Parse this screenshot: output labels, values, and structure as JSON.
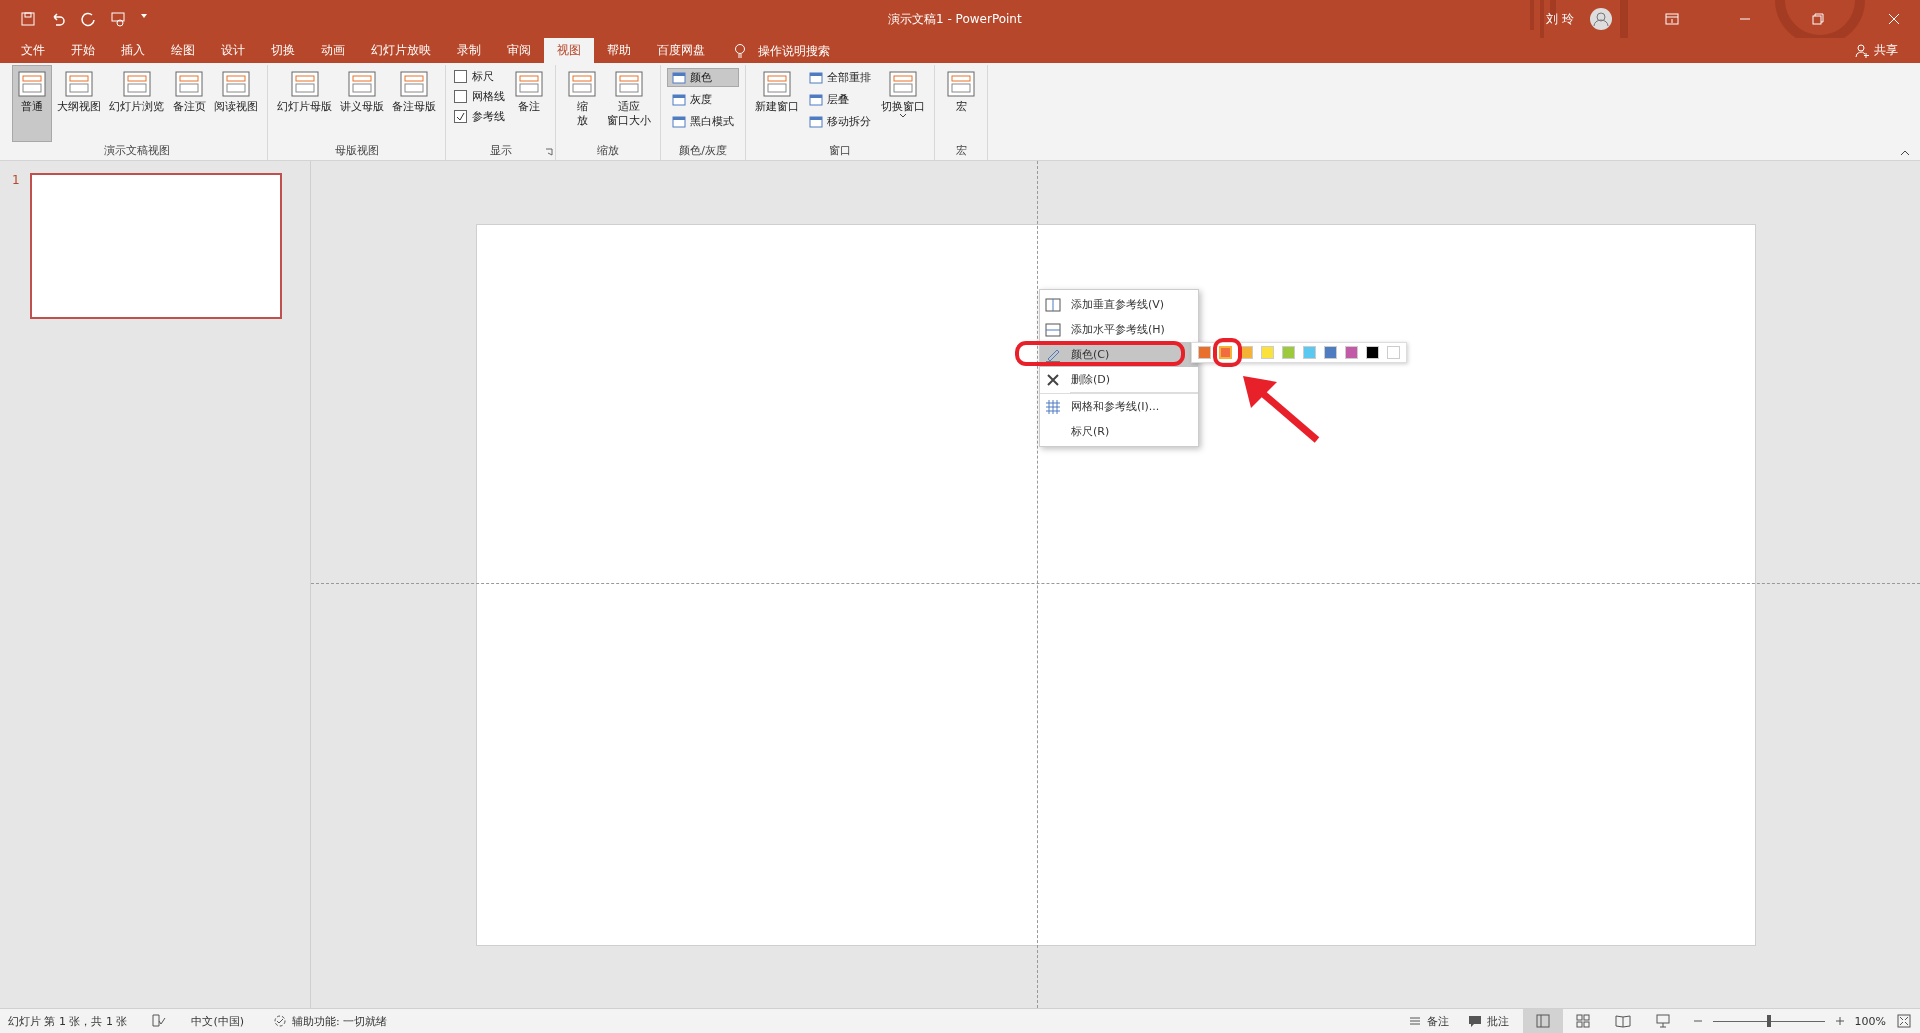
{
  "window": {
    "title": "演示文稿1  -  PowerPoint",
    "user": "刘 玲"
  },
  "tabs": [
    {
      "label": "文件",
      "selected": false
    },
    {
      "label": "开始",
      "selected": false
    },
    {
      "label": "插入",
      "selected": false
    },
    {
      "label": "绘图",
      "selected": false
    },
    {
      "label": "设计",
      "selected": false
    },
    {
      "label": "切换",
      "selected": false
    },
    {
      "label": "动画",
      "selected": false
    },
    {
      "label": "幻灯片放映",
      "selected": false
    },
    {
      "label": "录制",
      "selected": false
    },
    {
      "label": "审阅",
      "selected": false
    },
    {
      "label": "视图",
      "selected": true
    },
    {
      "label": "帮助",
      "selected": false
    },
    {
      "label": "百度网盘",
      "selected": false
    }
  ],
  "search": {
    "placeholder": "操作说明搜索"
  },
  "share": "共享",
  "ribbon": [
    {
      "label": "演示文稿视图",
      "items": [
        {
          "kind": "big",
          "label": "普通",
          "selected": true
        },
        {
          "kind": "big",
          "label": "大纲视图",
          "selected": false
        },
        {
          "kind": "big",
          "label": "幻灯片浏览",
          "selected": false
        },
        {
          "kind": "big",
          "label": "备注页",
          "selected": false
        },
        {
          "kind": "big",
          "label": "阅读视图",
          "selected": false
        }
      ]
    },
    {
      "label": "母版视图",
      "items": [
        {
          "kind": "big",
          "label": "幻灯片母版",
          "selected": false
        },
        {
          "kind": "big",
          "label": "讲义母版",
          "selected": false
        },
        {
          "kind": "big",
          "label": "备注母版",
          "selected": false
        }
      ]
    },
    {
      "label": "显示",
      "launcher": true,
      "items": [
        {
          "kind": "stack",
          "children": [
            {
              "kind": "check",
              "label": "标尺",
              "checked": false
            },
            {
              "kind": "check",
              "label": "网格线",
              "checked": false
            },
            {
              "kind": "check",
              "label": "参考线",
              "checked": true
            }
          ]
        },
        {
          "kind": "big",
          "label": "备注",
          "selected": false
        }
      ]
    },
    {
      "label": "缩放",
      "items": [
        {
          "kind": "big",
          "lines": [
            "缩",
            "放"
          ],
          "selected": false
        },
        {
          "kind": "big",
          "lines": [
            "适应",
            "窗口大小"
          ],
          "selected": false
        }
      ]
    },
    {
      "label": "颜色/灰度",
      "items": [
        {
          "kind": "stack",
          "children": [
            {
              "kind": "small",
              "label": "颜色",
              "selected": true
            },
            {
              "kind": "small",
              "label": "灰度",
              "selected": false
            },
            {
              "kind": "small",
              "label": "黑白模式",
              "selected": false
            }
          ]
        }
      ]
    },
    {
      "label": "窗口",
      "items": [
        {
          "kind": "big",
          "label": "新建窗口",
          "selected": false
        },
        {
          "kind": "stack",
          "children": [
            {
              "kind": "small",
              "label": "全部重排",
              "selected": false
            },
            {
              "kind": "small",
              "label": "层叠",
              "selected": false
            },
            {
              "kind": "small",
              "label": "移动拆分",
              "selected": false
            }
          ]
        },
        {
          "kind": "big",
          "label": "切换窗口",
          "selected": false,
          "dropdown": true
        }
      ]
    },
    {
      "label": "宏",
      "items": [
        {
          "kind": "big",
          "label": "宏",
          "selected": false
        }
      ]
    }
  ],
  "slides": [
    {
      "number": "1",
      "selected": true
    }
  ],
  "context_menu": {
    "items": [
      {
        "label": "添加垂直参考线(V)",
        "kind": "vguide",
        "highlighted": false
      },
      {
        "label": "添加水平参考线(H)",
        "kind": "hguide",
        "highlighted": false
      },
      {
        "label": "颜色(C)",
        "kind": "color",
        "highlighted": true
      },
      {
        "label": "删除(D)",
        "kind": "delete",
        "highlighted": false
      },
      {
        "label": "网格和参考线(I)...",
        "kind": "grid",
        "highlighted": false,
        "separator": true
      },
      {
        "label": "标尺(R)",
        "kind": "none",
        "highlighted": false
      }
    ]
  },
  "palette": [
    {
      "color": "#e8702a",
      "selected": false
    },
    {
      "color": "#f26b43",
      "selected": true
    },
    {
      "color": "#f5b335",
      "selected": false
    },
    {
      "color": "#fbe13b",
      "selected": false
    },
    {
      "color": "#9dc93c",
      "selected": false
    },
    {
      "color": "#5bc9ef",
      "selected": false
    },
    {
      "color": "#4f7bc1",
      "selected": false
    },
    {
      "color": "#c25aa7",
      "selected": false
    },
    {
      "color": "#000000",
      "selected": false
    },
    {
      "color": "#ffffff",
      "selected": false
    }
  ],
  "status_bar": {
    "slide_info": "幻灯片 第 1 张，共 1 张",
    "language": "中文(中国)",
    "accessibility": "辅助功能: 一切就绪",
    "notes": "备注",
    "comments": "批注",
    "views": [
      {
        "kind": "normal",
        "selected": true
      },
      {
        "kind": "sorter",
        "selected": false
      },
      {
        "kind": "reading",
        "selected": false
      },
      {
        "kind": "slideshow",
        "selected": false
      }
    ],
    "zoom": {
      "level": 0.5,
      "reading": "100%"
    }
  }
}
